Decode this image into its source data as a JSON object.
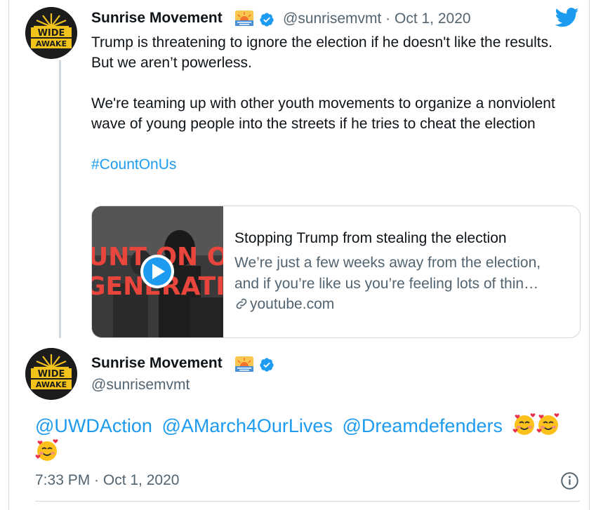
{
  "quoted_tweet": {
    "author_name": "Sunrise Movement",
    "handle_time": "@sunrisemvmt · Oct 1, 2020",
    "paragraph_1": "Trump is threatening to ignore the election if he doesn't like the results. But we aren’t powerless.",
    "paragraph_2": "We're teaming up with other youth movements to organize a nonviolent wave of young people into the streets if he tries to cheat the election",
    "hashtag": "#CountOnUs",
    "card": {
      "title": "Stopping Trump from stealing the election",
      "description": "We’re just a few weeks away from the election, and if you’re like us you’re feeling lots of thin…",
      "domain": "youtube.com",
      "thumb_text_1": "UNT ON OU",
      "thumb_text_2": "GENERATION"
    }
  },
  "main_tweet": {
    "author_name": "Sunrise Movement",
    "handle": "@sunrisemvmt",
    "mentions": [
      "@UWDAction",
      "@AMarch4OurLives",
      "@Dreamdefenders"
    ],
    "timestamp": "7:33 PM · Oct 1, 2020"
  },
  "avatar_text": {
    "line1": "WIDE",
    "line2": "AWAKE"
  },
  "icons": {
    "logo": "twitter-bird-icon",
    "verified": "verified-badge-icon",
    "sunrise": "sunrise-emoji-icon",
    "play": "play-icon",
    "link": "link-icon",
    "info": "info-icon",
    "emoji": "smiling-face-with-hearts-emoji"
  },
  "colors": {
    "accent": "#1d9bf0",
    "secondary_text": "#536471",
    "border": "#cfd9de",
    "avatar_yellow": "#f2c31a"
  }
}
